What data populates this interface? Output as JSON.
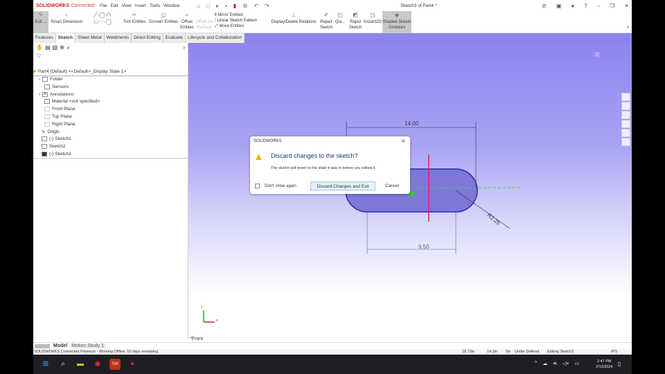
{
  "app": {
    "brand": "SOLIDWORKS",
    "brand_suffix": "Connected",
    "menu": [
      "File",
      "Edit",
      "View",
      "Insert",
      "Tools",
      "Window"
    ],
    "doc_title": "Sketch3 of Part4 *"
  },
  "toolbar": [
    {
      "label": "Exit ...",
      "icon": "exit-sketch-icon"
    },
    {
      "label": "Smart Dimension",
      "icon": "smart-dimension-icon"
    },
    {
      "label": "Trim Entities",
      "icon": "trim-icon"
    },
    {
      "label": "Convert Entities",
      "icon": "convert-icon"
    },
    {
      "label": "Offset Entities",
      "icon": "offset-icon"
    },
    {
      "label": "Offset On Surface",
      "icon": "offset-surface-icon"
    },
    {
      "label": "Mirror Entities",
      "icon": "mirror-icon"
    },
    {
      "label": "Linear Sketch Pattern",
      "icon": "pattern-icon"
    },
    {
      "label": "Move Entities",
      "icon": "move-icon"
    },
    {
      "label": "Display/Delete Relations",
      "icon": "relations-icon"
    },
    {
      "label": "Repair Sketch",
      "icon": "repair-icon"
    },
    {
      "label": "Qui...",
      "icon": "quick-snaps-icon"
    },
    {
      "label": "Rapid Sketch",
      "icon": "rapid-sketch-icon"
    },
    {
      "label": "Instant2D",
      "icon": "instant2d-icon"
    },
    {
      "label": "Shaded Sketch Contours",
      "icon": "shaded-contours-icon"
    }
  ],
  "tabs": [
    "Features",
    "Sketch",
    "Sheet Metal",
    "Weldments",
    "Direct Editing",
    "Evaluate",
    "Lifecycle and Collaboration"
  ],
  "selected_tab": "Sketch",
  "tree": {
    "root": "Part4 (Default) <<Default>_Display State 1>",
    "items": [
      "Folder",
      "Sensors",
      "Annotations",
      "Material <not specified>",
      "Front Plane",
      "Top Plane",
      "Right Plane",
      "Origin",
      "(-) Sketch1",
      "Sketch2",
      "(-) Sketch3"
    ]
  },
  "sketch": {
    "dim_overall": "14.00",
    "dim_center": "9.50",
    "dim_radius": "R2.25",
    "view_label": "*Front",
    "axis_x": "x",
    "axis_y": "y",
    "colors": {
      "profile": "#2a2ab0",
      "fill": "#7d78d8",
      "centerline": "#33dd33",
      "vertical": "#e0204a"
    }
  },
  "dialog": {
    "title": "SOLIDWORKS",
    "heading": "Discard changes to the sketch?",
    "message": "The sketch will revert to the state it was in before you edited it.",
    "checkbox": "Don't show again",
    "checkbox_checked": false,
    "primary": "Discard Changes and Exit",
    "cancel": "Cancel"
  },
  "bottom_tabs": [
    "Model",
    "Motion Study 1"
  ],
  "status": {
    "left": "SOLIDWORKS Connected Premium - Working Offline: 10 days remaining",
    "x": "18.73in",
    "y": "14.3in",
    "z": "0in",
    "state": "Under Defined",
    "editing": "Editing Sketch3",
    "units": "IPS"
  },
  "taskbar": {
    "time": "2:47 PM",
    "date": "2/13/2024"
  }
}
